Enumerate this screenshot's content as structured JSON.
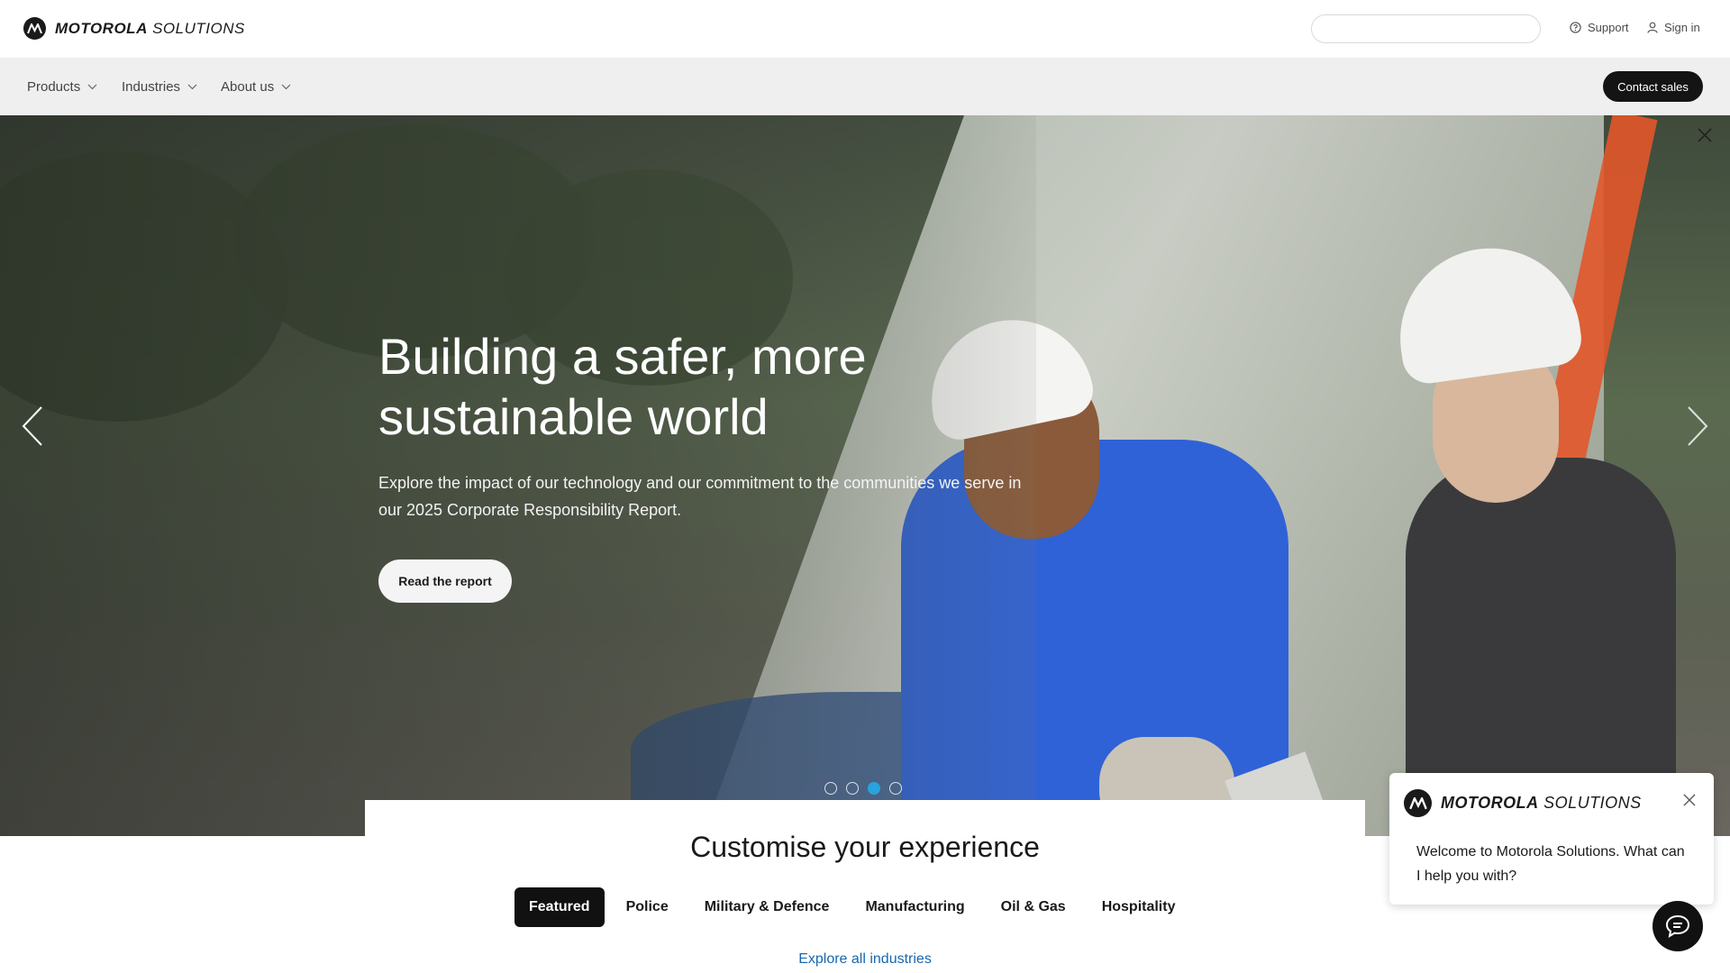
{
  "header": {
    "brand_bold": "MOTOROLA",
    "brand_light": " SOLUTIONS",
    "search_placeholder": "",
    "support_label": "Support",
    "signin_label": "Sign in"
  },
  "nav": {
    "items": [
      {
        "label": "Products"
      },
      {
        "label": "Industries"
      },
      {
        "label": "About us"
      }
    ],
    "contact_label": "Contact sales"
  },
  "hero": {
    "title": "Building a safer, more sustainable world",
    "description": "Explore the impact of our technology and our commitment to the communities we serve in our 2025 Corporate Responsibility Report.",
    "button_label": "Read the report",
    "active_slide": 3,
    "slide_count": 4
  },
  "customise": {
    "title": "Customise your experience",
    "tabs": [
      {
        "label": "Featured",
        "active": true
      },
      {
        "label": "Police",
        "active": false
      },
      {
        "label": "Military & Defence",
        "active": false
      },
      {
        "label": "Manufacturing",
        "active": false
      },
      {
        "label": "Oil & Gas",
        "active": false
      },
      {
        "label": "Hospitality",
        "active": false
      }
    ],
    "explore_link": "Explore all industries"
  },
  "chat": {
    "brand_bold": "MOTOROLA",
    "brand_light": " SOLUTIONS",
    "message": "Welcome to Motorola Solutions. What can I help you with?"
  },
  "colors": {
    "accent_link": "#1768b0",
    "active_dot": "#29a3de",
    "dark_button": "#141414"
  }
}
